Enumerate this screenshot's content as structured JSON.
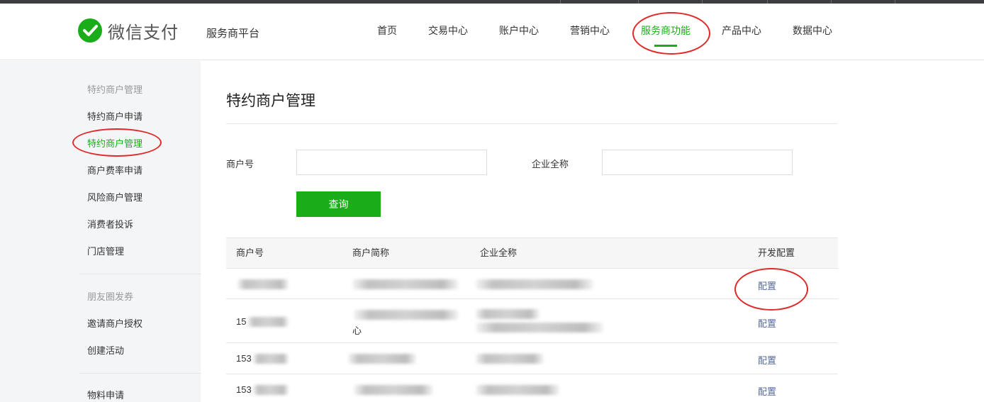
{
  "brand": {
    "logo_text": "微信支付",
    "platform": "服务商平台",
    "accent": "#1aad19",
    "logo_icon": "wechat-pay-check-icon"
  },
  "nav": {
    "items": [
      {
        "label": "首页"
      },
      {
        "label": "交易中心"
      },
      {
        "label": "账户中心"
      },
      {
        "label": "营销中心"
      },
      {
        "label": "服务商功能",
        "active": true
      },
      {
        "label": "产品中心"
      },
      {
        "label": "数据中心"
      }
    ]
  },
  "sidebar": {
    "group1": {
      "title": "特约商户管理",
      "items": [
        "特约商户申请",
        "特约商户管理",
        "商户费率申请",
        "风险商户管理",
        "消费者投诉",
        "门店管理"
      ]
    },
    "group2": {
      "title": "朋友圈发券",
      "items": [
        "邀请商户授权",
        "创建活动"
      ]
    },
    "group3": {
      "items": [
        "物料申请"
      ]
    }
  },
  "main": {
    "title": "特约商户管理",
    "form": {
      "merchant_id_label": "商户号",
      "merchant_id_value": "",
      "company_label": "企业全称",
      "company_value": "",
      "query_button": "查询"
    },
    "table": {
      "headers": [
        "商户号",
        "商户简称",
        "企业全称",
        "开发配置"
      ],
      "rows": [
        {
          "merchant_id": "",
          "short_name": "",
          "full_name": "",
          "action": "配置"
        },
        {
          "merchant_id": "15",
          "short_name": "心",
          "full_name": "",
          "action": "配置"
        },
        {
          "merchant_id": "153",
          "short_name": "",
          "full_name": "",
          "action": "配置"
        },
        {
          "merchant_id": "153",
          "short_name": "",
          "full_name": "",
          "action": "配置"
        }
      ]
    }
  },
  "colors": {
    "link": "#576b95",
    "annotation": "#e02a2a",
    "sidebar_bg": "#f4f5f7"
  }
}
